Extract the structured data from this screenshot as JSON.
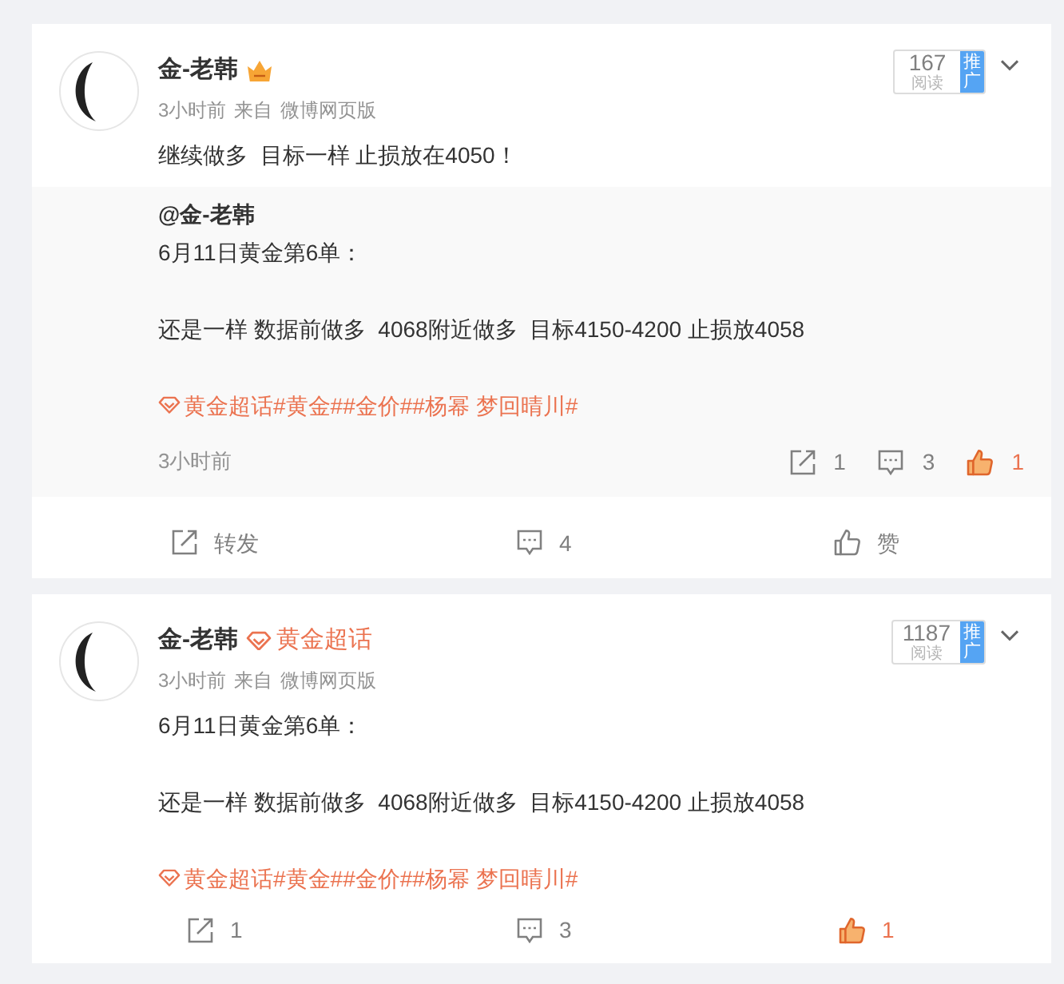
{
  "posts": [
    {
      "author": "金-老韩",
      "badge": {
        "kind": "member"
      },
      "time": "3小时前",
      "via": "来自",
      "source": "微博网页版",
      "reads": {
        "count": "167",
        "label": "阅读",
        "promo": "推广"
      },
      "body": {
        "paragraphs": [
          "继续做多  目标一样 止损放在4050！"
        ]
      },
      "retweet": {
        "author": "@金-老韩",
        "body": {
          "paragraphs": [
            "6月11日黄金第6单：",
            "还是一样 数据前做多  4068附近做多  目标4150-4200 止损放4058"
          ],
          "topics": [
            {
              "kind": "super_topic",
              "label": "黄金超话"
            },
            {
              "kind": "hashtag",
              "label": "#黄金#"
            },
            {
              "kind": "hashtag",
              "label": "#金价#"
            },
            {
              "kind": "hashtag",
              "label": "#杨幂 梦回晴川#"
            }
          ]
        },
        "time": "3小时前",
        "stats": [
          {
            "kind": "repost",
            "label": "1",
            "active": false
          },
          {
            "kind": "comment",
            "label": "3",
            "active": false
          },
          {
            "kind": "like",
            "label": "1",
            "active": true
          }
        ]
      },
      "actions": {
        "kind": "bar",
        "items": [
          {
            "kind": "repost",
            "label": "转发",
            "active": false
          },
          {
            "kind": "comment",
            "label": "4",
            "active": false
          },
          {
            "kind": "like",
            "label": "赞",
            "active": false
          }
        ]
      }
    },
    {
      "author": "金-老韩",
      "badge": {
        "kind": "super_topic",
        "label": "黄金超话"
      },
      "time": "3小时前",
      "via": "来自",
      "source": "微博网页版",
      "reads": {
        "count": "1187",
        "label": "阅读",
        "promo": "推广"
      },
      "body": {
        "paragraphs": [
          "6月11日黄金第6单：",
          "还是一样 数据前做多  4068附近做多  目标4150-4200 止损放4058"
        ],
        "topics": [
          {
            "kind": "super_topic",
            "label": "黄金超话"
          },
          {
            "kind": "hashtag",
            "label": "#黄金#"
          },
          {
            "kind": "hashtag",
            "label": "#金价#"
          },
          {
            "kind": "hashtag",
            "label": "#杨幂 梦回晴川#"
          }
        ]
      },
      "actions": {
        "kind": "inline",
        "items": [
          {
            "kind": "repost",
            "label": "1",
            "active": false
          },
          {
            "kind": "comment",
            "label": "3",
            "active": false
          },
          {
            "kind": "like",
            "label": "1",
            "active": true
          }
        ]
      }
    }
  ]
}
